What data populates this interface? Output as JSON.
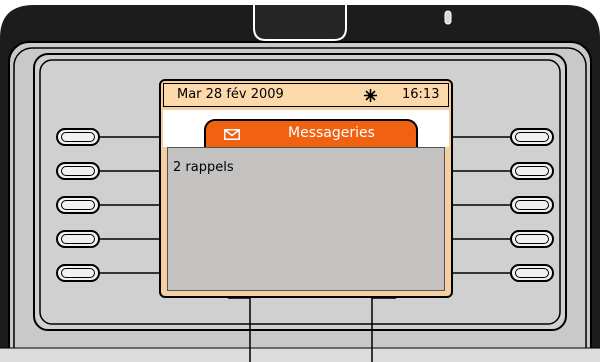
{
  "status_bar": {
    "date": "Mar 28 fév 2009",
    "icon": "sun-icon",
    "time": "16:13"
  },
  "tab": {
    "icon": "envelope-icon",
    "label": "Messageries"
  },
  "content": {
    "lines": [
      "2 rappels"
    ]
  },
  "softkeys": {
    "left": [
      "",
      "",
      "",
      "",
      ""
    ],
    "right": [
      "",
      "",
      "",
      "",
      ""
    ]
  },
  "colors": {
    "tab_orange": "#f06212",
    "screen_frame": "#f3cfa2",
    "status_bar": "#fbd9ab",
    "content_gray": "#c4c2c1",
    "phone_dark": "#1c1c1c",
    "phone_gray": "#cdcdcd"
  }
}
